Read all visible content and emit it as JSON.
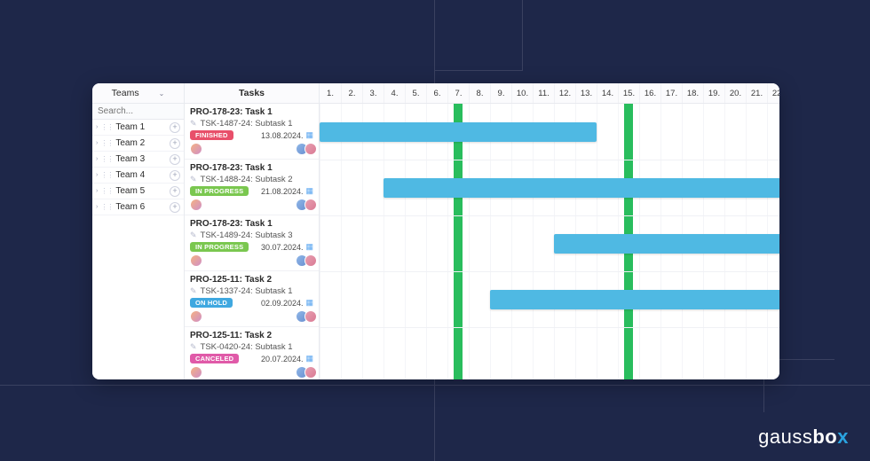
{
  "header": {
    "teams_label": "Teams",
    "tasks_label": "Tasks",
    "days": [
      "1.",
      "2.",
      "3.",
      "4.",
      "5.",
      "6.",
      "7.",
      "8.",
      "9.",
      "10.",
      "11.",
      "12.",
      "13.",
      "14.",
      "15.",
      "16.",
      "17.",
      "18.",
      "19.",
      "20.",
      "21.",
      "22."
    ]
  },
  "search_placeholder": "Search...",
  "teams": [
    {
      "name": "Team 1"
    },
    {
      "name": "Team 2"
    },
    {
      "name": "Team 3"
    },
    {
      "name": "Team 4"
    },
    {
      "name": "Team 5"
    },
    {
      "name": "Team 6"
    }
  ],
  "status_colors": {
    "FINISHED": "#e84f6a",
    "IN PROGRESS": "#7ac74f",
    "ON HOLD": "#3fa8e0",
    "CANCELED": "#e05aa8"
  },
  "tasks": [
    {
      "title": "PRO-178-23: Task 1",
      "subtask": "TSK-1487-24: Subtask 1",
      "status": "FINISHED",
      "date": "13.08.2024.",
      "bar_start": 1,
      "bar_end": 13
    },
    {
      "title": "PRO-178-23: Task 1",
      "subtask": "TSK-1488-24: Subtask 2",
      "status": "IN PROGRESS",
      "date": "21.08.2024.",
      "bar_start": 4,
      "bar_end": 22
    },
    {
      "title": "PRO-178-23: Task 1",
      "subtask": "TSK-1489-24: Subtask 3",
      "status": "IN PROGRESS",
      "date": "30.07.2024.",
      "bar_start": 12,
      "bar_end": 22
    },
    {
      "title": "PRO-125-11: Task 2",
      "subtask": "TSK-1337-24: Subtask 1",
      "status": "ON HOLD",
      "date": "02.09.2024.",
      "bar_start": 9,
      "bar_end": 22
    },
    {
      "title": "PRO-125-11: Task 2",
      "subtask": "TSK-0420-24: Subtask 1",
      "status": "CANCELED",
      "date": "20.07.2024.",
      "bar_start": null,
      "bar_end": null
    }
  ],
  "weekend_cols": [
    7,
    15
  ],
  "logo": {
    "pre": "gauss",
    "bold": "bo",
    "x": "x"
  }
}
